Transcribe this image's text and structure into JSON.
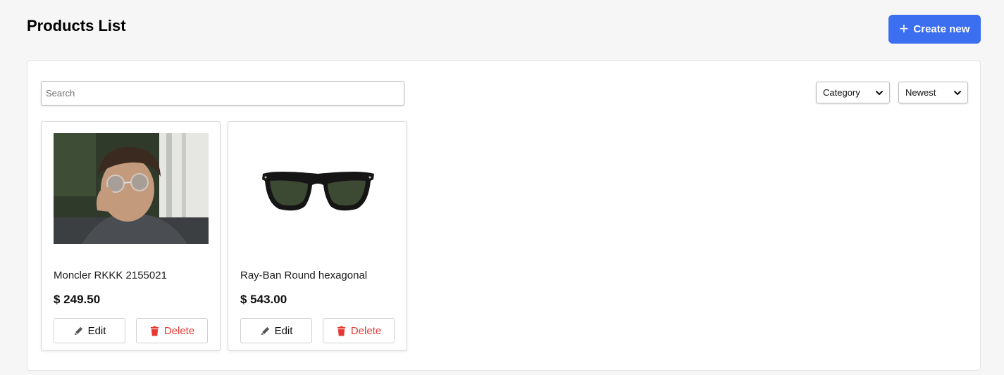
{
  "header": {
    "title": "Products List",
    "create_label": "Create new"
  },
  "filters": {
    "search_placeholder": "Search",
    "category_label": "Category",
    "sort_label": "Newest"
  },
  "products": [
    {
      "name": "Moncler RKKK 2155021",
      "price": "$ 249.50",
      "edit_label": "Edit",
      "delete_label": "Delete"
    },
    {
      "name": "Ray-Ban Round hexagonal",
      "price": "$ 543.00",
      "edit_label": "Edit",
      "delete_label": "Delete"
    }
  ],
  "colors": {
    "accent": "#3b6ff0",
    "danger": "#e53935"
  },
  "icons": [
    "plus-icon",
    "chevron-down-icon",
    "pencil-icon",
    "trash-icon"
  ]
}
